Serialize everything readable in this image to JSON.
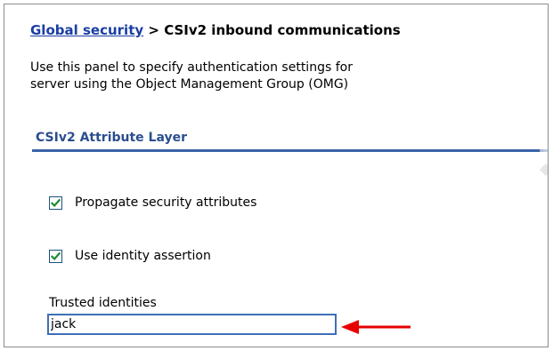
{
  "breadcrumb": {
    "link": "Global security",
    "separator": ">",
    "current": "CSIv2 inbound communications"
  },
  "intro": {
    "line1": "Use this panel to specify authentication settings for",
    "line2": "server using the Object Management Group (OMG)"
  },
  "section": {
    "title": "CSIv2 Attribute Layer"
  },
  "options": {
    "propagate": {
      "label": "Propagate security attributes",
      "checked": true
    },
    "identity_assertion": {
      "label": "Use identity assertion",
      "checked": true
    }
  },
  "trusted_identities": {
    "label": "Trusted identities",
    "value": "jack"
  },
  "colors": {
    "link": "#1a3ea3",
    "section_title": "#2a4d8f",
    "rule": "#3b64a6",
    "checkmark": "#1e8c32",
    "input_border": "#3f6fb5",
    "arrow": "#e60000"
  },
  "icons": {
    "checkbox": "checkmark-icon",
    "annotation": "red-arrow-icon"
  }
}
